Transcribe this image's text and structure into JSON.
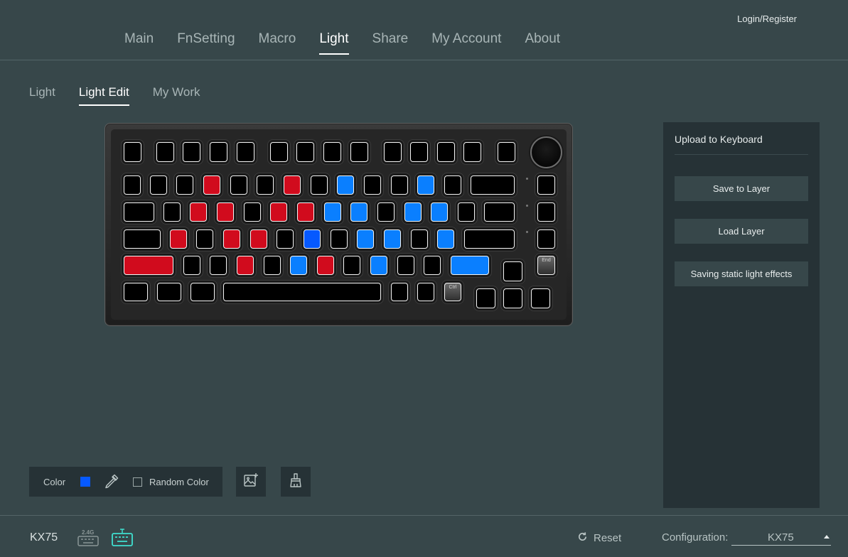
{
  "header": {
    "login_label": "Login/Register",
    "nav": [
      "Main",
      "FnSetting",
      "Macro",
      "Light",
      "Share",
      "My Account",
      "About"
    ],
    "active_nav": "Light"
  },
  "subnav": {
    "tabs": [
      "Light",
      "Light Edit",
      "My Work"
    ],
    "active_tab": "Light Edit"
  },
  "keyboard": {
    "key_colors": {
      "red": "#d10b1d",
      "blue": "#0a7fff",
      "dark_blue": "#0659ff",
      "black": "#000000"
    },
    "legends": {
      "end": "End",
      "ctrl": "Ctrl"
    }
  },
  "panel": {
    "title": "Upload to Keyboard",
    "buttons": [
      "Save to Layer",
      "Load Layer",
      "Saving static light effects"
    ]
  },
  "toolbar": {
    "color_label": "Color",
    "selected_color": "#0659ff",
    "random_color_label": "Random Color",
    "random_color_checked": false,
    "icons": [
      "eyedropper-icon",
      "image-import-icon",
      "brush-clear-icon"
    ]
  },
  "footer": {
    "device_name": "KX75",
    "wireless_badge": "2.4G",
    "reset_label": "Reset",
    "config_label": "Configuration:",
    "config_value": "KX75"
  }
}
